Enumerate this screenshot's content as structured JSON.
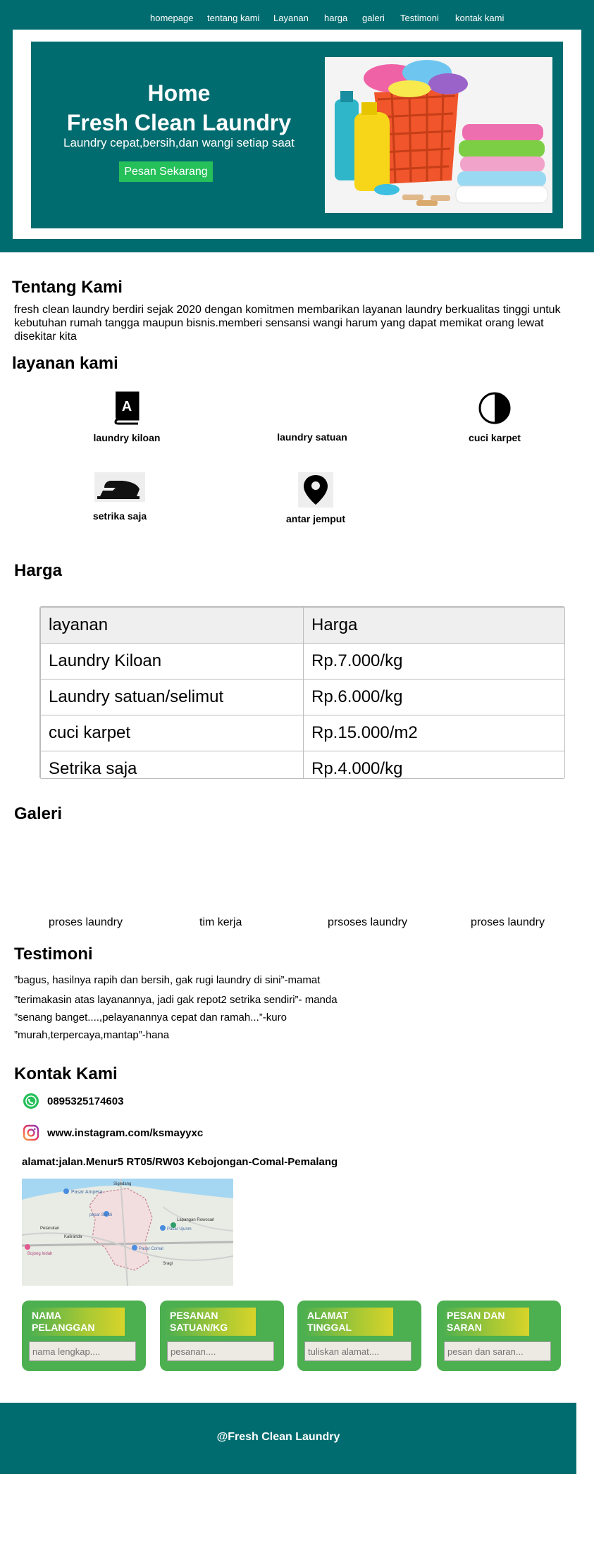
{
  "nav": {
    "items": [
      "homepage",
      "tentang kami",
      "Layanan",
      "harga",
      "galeri",
      "Testimoni",
      "kontak kami"
    ]
  },
  "hero": {
    "title_line1": "Home",
    "title_line2": "Fresh Clean Laundry",
    "subtitle": "Laundry cepat,bersih,dan wangi setiap saat",
    "button": "Pesan Sekarang"
  },
  "about": {
    "heading": "Tentang Kami",
    "text": "fresh clean laundry berdiri sejak 2020 dengan komitmen membarikan layanan laundry berkualitas tinggi untuk kebutuhan rumah tangga maupun bisnis.memberi sensansi wangi harum yang dapat memikat orang lewat disekitar kita"
  },
  "services": {
    "heading": "layanan kami",
    "items": [
      {
        "label": "laundry kiloan",
        "icon": "book-icon"
      },
      {
        "label": "laundry satuan",
        "icon": ""
      },
      {
        "label": "cuci karpet",
        "icon": "half-circle-icon"
      },
      {
        "label": "setrika saja",
        "icon": "iron-icon"
      },
      {
        "label": "antar jemput",
        "icon": "map-pin-icon"
      }
    ]
  },
  "pricing": {
    "heading": "Harga",
    "columns": [
      "layanan",
      "Harga"
    ],
    "rows": [
      [
        "Laundry Kiloan",
        "Rp.7.000/kg"
      ],
      [
        "Laundry satuan/selimut",
        "Rp.6.000/kg"
      ],
      [
        "cuci karpet",
        "Rp.15.000/m2"
      ],
      [
        "Setrika saja",
        "Rp.4.000/kg"
      ]
    ]
  },
  "gallery": {
    "heading": "Galeri",
    "captions": [
      "proses laundry",
      "tim kerja",
      "prsoses laundry",
      "proses laundry"
    ]
  },
  "testimonials": {
    "heading": "Testimoni",
    "items": [
      "”bagus, hasilnya rapih dan bersih, gak rugi laundry di sini”-mamat",
      "”terimakasin atas layanannya, jadi gak repot2 setrika sendiri”-  manda",
      "”senang banget....,pelayanannya cepat dan ramah...”-kuro",
      "”murah,terpercaya,mantap”-hana"
    ]
  },
  "contact": {
    "heading": "Kontak Kami",
    "phone": "0895325174603",
    "instagram": "www.instagram.com/ksmayyxc",
    "address": "alamat:jalan.Menur5 RT05/RW03 Kebojongan-Comal-Pemalang",
    "map_labels": [
      "Sigedang",
      "Pasar Ampera",
      "pasar Sendi",
      "Petarukan",
      "Kaliranda",
      "Lapangan Rowosari",
      "Pasar Ujunm",
      "Pasar Comal",
      "Sragi",
      "Bojong Indah"
    ]
  },
  "form": {
    "cards": [
      {
        "label": "NAMA PELANGGAN",
        "placeholder": "nama lengkap...."
      },
      {
        "label": "PESANAN SATUAN/KG",
        "placeholder": "pesanan...."
      },
      {
        "label": "ALAMAT TINGGAL",
        "placeholder": "tuliskan alamat...."
      },
      {
        "label": "PESAN DAN SARAN",
        "placeholder": "pesan dan saran..."
      }
    ]
  },
  "footer": {
    "text": "@Fresh Clean Laundry"
  },
  "colors": {
    "teal": "#006c6f",
    "green_button": "#25c05a",
    "card_green": "#4caf50"
  }
}
